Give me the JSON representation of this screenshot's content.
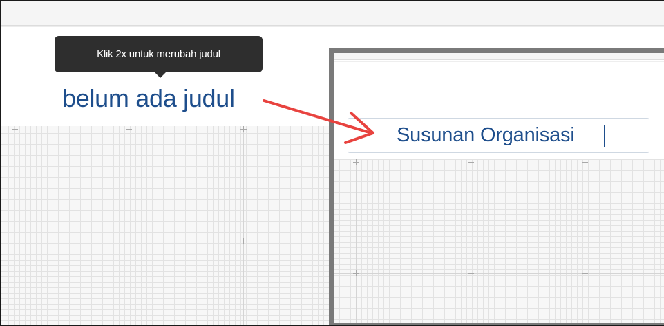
{
  "tooltip": {
    "text": "Klik 2x untuk merubah judul"
  },
  "canvas": {
    "title_placeholder": "belum ada judul"
  },
  "zoom": {
    "title_input_value": "Susunan Organisasi"
  },
  "colors": {
    "title_blue": "#1e4e8c",
    "tooltip_bg": "#2e2e2e",
    "arrow_red": "#e8433f",
    "frame_gray": "#7a7a7a",
    "grid_line": "#e2e2e2"
  },
  "icons": {
    "grid_marker": "plus-marker-icon",
    "callout": "red-arrow-icon"
  }
}
